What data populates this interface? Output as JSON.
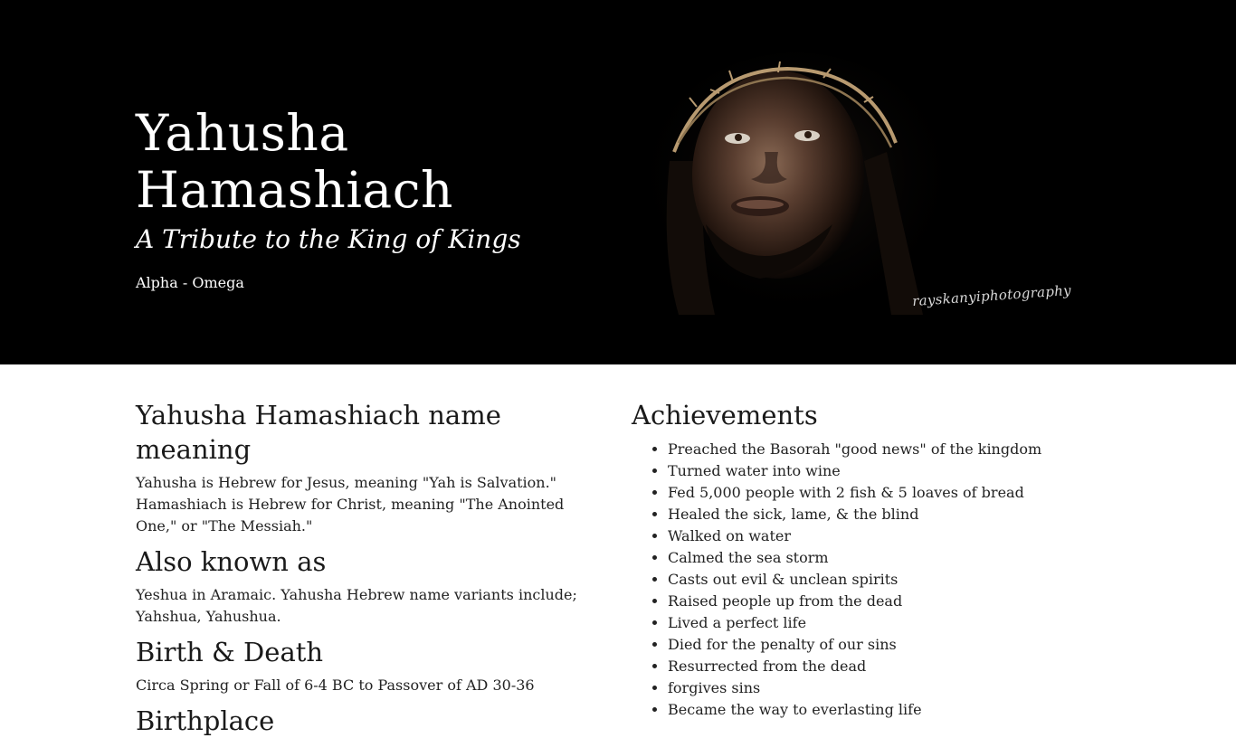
{
  "hero": {
    "title": "Yahusha Hamashiach",
    "subtitle": "A Tribute to the King of Kings",
    "tagline": "Alpha - Omega",
    "image_watermark": "rayskanyiphotography"
  },
  "sections": {
    "name_meaning": {
      "heading": "Yahusha Hamashiach name meaning",
      "text": "Yahusha is Hebrew for Jesus, meaning \"Yah is Salvation.\" Hamashiach is Hebrew for Christ, meaning \"The Anointed One,\" or \"The Messiah.\""
    },
    "also_known_as": {
      "heading": "Also known as",
      "text": "Yeshua in Aramaic. Yahusha Hebrew name variants include; Yahshua, Yahushua."
    },
    "birth_death": {
      "heading": "Birth & Death",
      "text": "Circa Spring or Fall of 6-4 BC to Passover of AD 30-36"
    },
    "birthplace": {
      "heading": "Birthplace"
    },
    "achievements": {
      "heading": "Achievements",
      "items": [
        "Preached the Basorah \"good news\" of the kingdom",
        "Turned water into wine",
        "Fed 5,000 people with 2 fish & 5 loaves of bread",
        "Healed the sick, lame, & the blind",
        "Walked on water",
        "Calmed the sea storm",
        "Casts out evil & unclean spirits",
        "Raised people up from the dead",
        "Lived a perfect life",
        "Died for the penalty of our sins",
        "Resurrected from the dead",
        "forgives sins",
        "Became the way to everlasting life"
      ]
    }
  }
}
